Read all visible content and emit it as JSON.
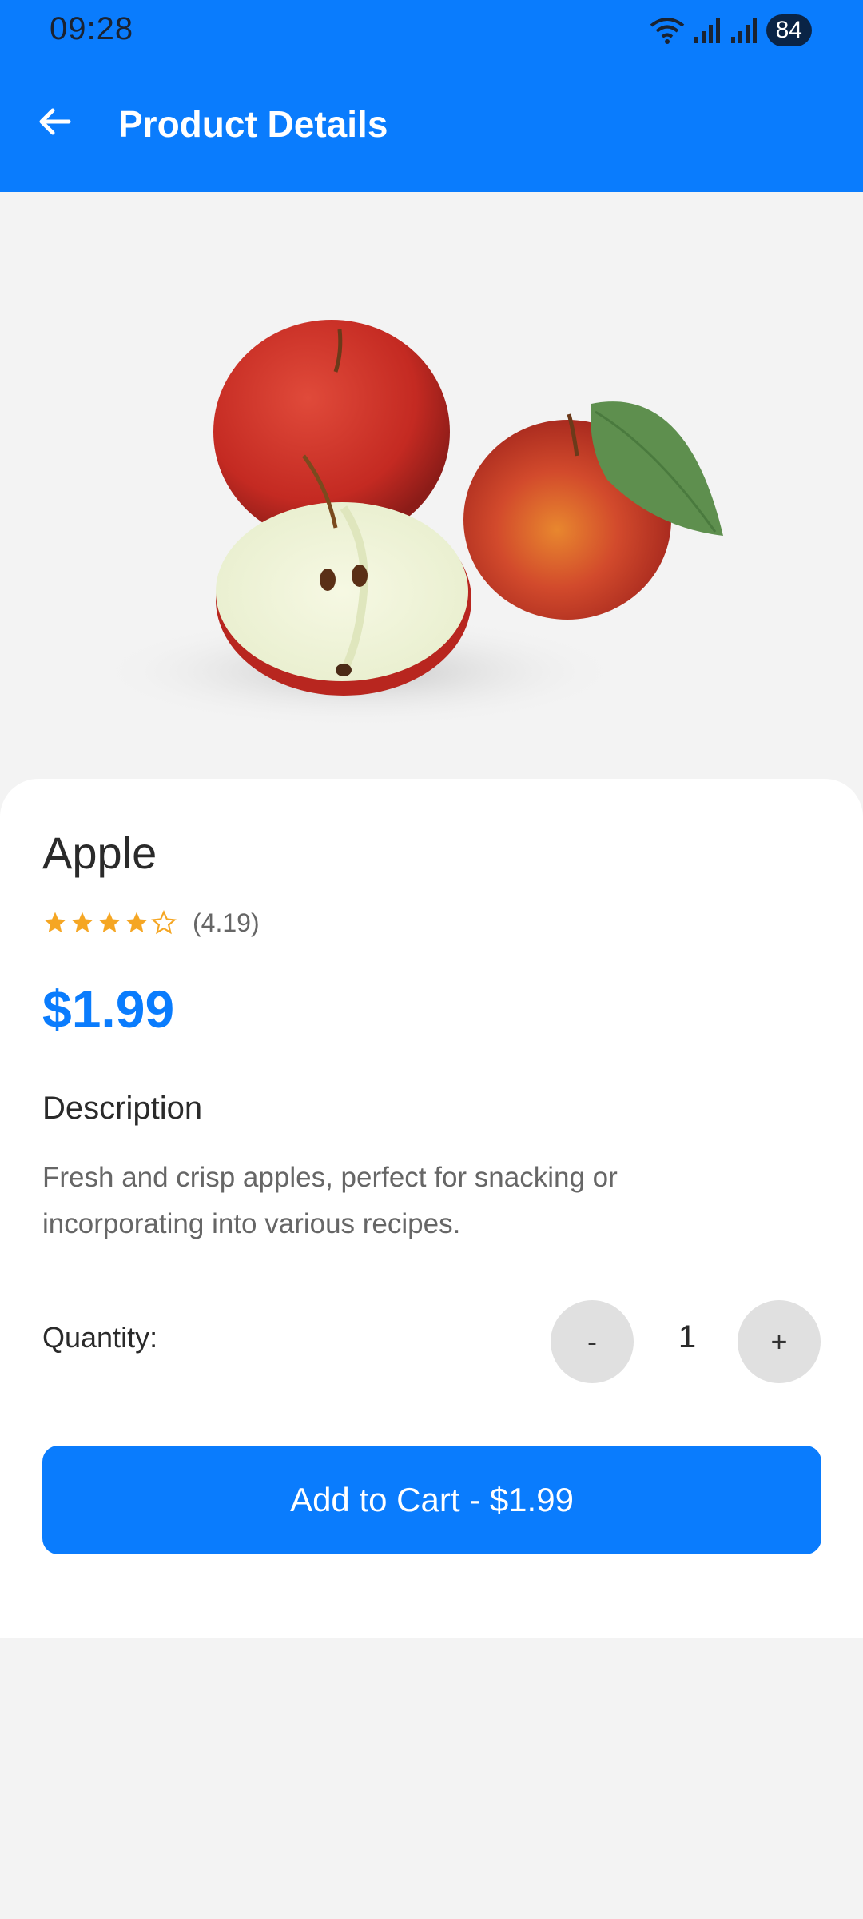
{
  "status_bar": {
    "time": "09:28",
    "battery": "84"
  },
  "header": {
    "title": "Product Details",
    "back_icon": "arrow-left-icon"
  },
  "product": {
    "name": "Apple",
    "rating": 4.19,
    "rating_text": "(4.19)",
    "stars_filled": 4,
    "stars_total": 5,
    "price": "$1.99",
    "description_title": "Description",
    "description": "Fresh and crisp apples, perfect for snacking or incorporating into various recipes."
  },
  "quantity": {
    "label": "Quantity:",
    "value": "1",
    "decrement": "-",
    "increment": "+"
  },
  "cart": {
    "button_label": "Add to Cart - $1.99"
  },
  "colors": {
    "accent": "#0a7cfd",
    "star": "#f5a623"
  }
}
